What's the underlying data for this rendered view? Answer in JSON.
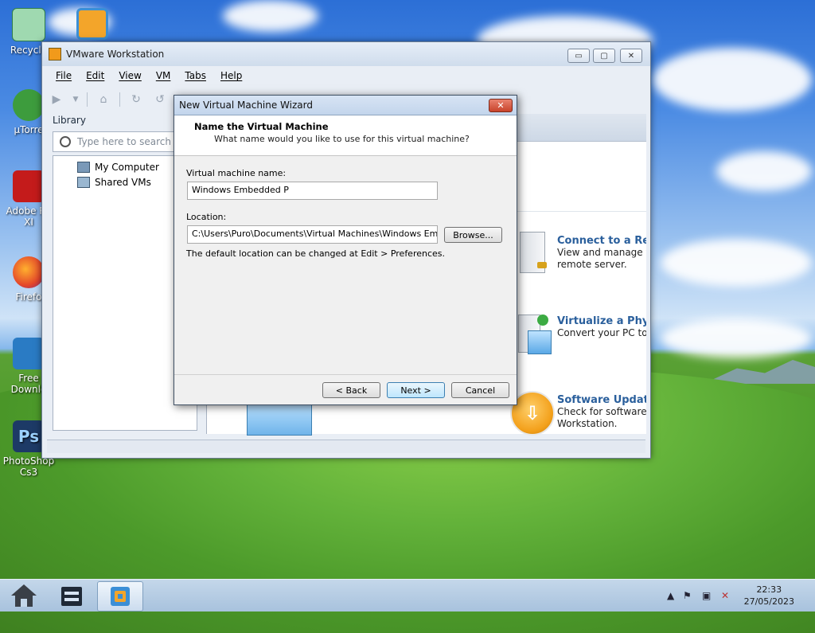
{
  "desktop": {
    "icons": [
      {
        "label": "Recycle"
      },
      {
        "label": ""
      },
      {
        "label": "µTorre"
      },
      {
        "label": "Adobe Re\nXI"
      },
      {
        "label": "Firefo"
      },
      {
        "label": "Free\nDownlo"
      },
      {
        "label": "PhotoShop\nCs3"
      }
    ]
  },
  "window": {
    "title": "VMware Workstation",
    "controls": {
      "minimize": "▭",
      "restore": "▢",
      "close": "✕"
    },
    "menu": [
      "File",
      "Edit",
      "View",
      "VM",
      "Tabs",
      "Help"
    ],
    "library": {
      "title": "Library",
      "search_placeholder": "Type here to search",
      "tree": [
        "My Computer",
        "Shared VMs"
      ]
    },
    "home_actions": [
      {
        "title": "Connect to a Re",
        "desc": [
          "View and manage v",
          "remote server."
        ]
      },
      {
        "title": "Virtualize a Phys",
        "desc": [
          "Convert your PC to"
        ]
      },
      {
        "title": "Software Update",
        "desc": [
          "Check for software",
          "Workstation."
        ]
      }
    ]
  },
  "dialog": {
    "title": "New Virtual Machine Wizard",
    "close": "✕",
    "heading": "Name the Virtual Machine",
    "subheading": "What name would you like to use for this virtual machine?",
    "name_label": "Virtual machine name:",
    "name_value": "Windows Embedded P",
    "location_label": "Location:",
    "location_value": "C:\\Users\\Puro\\Documents\\Virtual Machines\\Windows Embedded",
    "browse": "Browse...",
    "note": "The default location can be changed at Edit > Preferences.",
    "back": "< Back",
    "next": "Next >",
    "cancel": "Cancel"
  },
  "taskbar": {
    "time": "22:33",
    "date": "27/05/2023"
  },
  "colors": {
    "accent": "#2a5f9c",
    "close_red": "#c8432b"
  }
}
